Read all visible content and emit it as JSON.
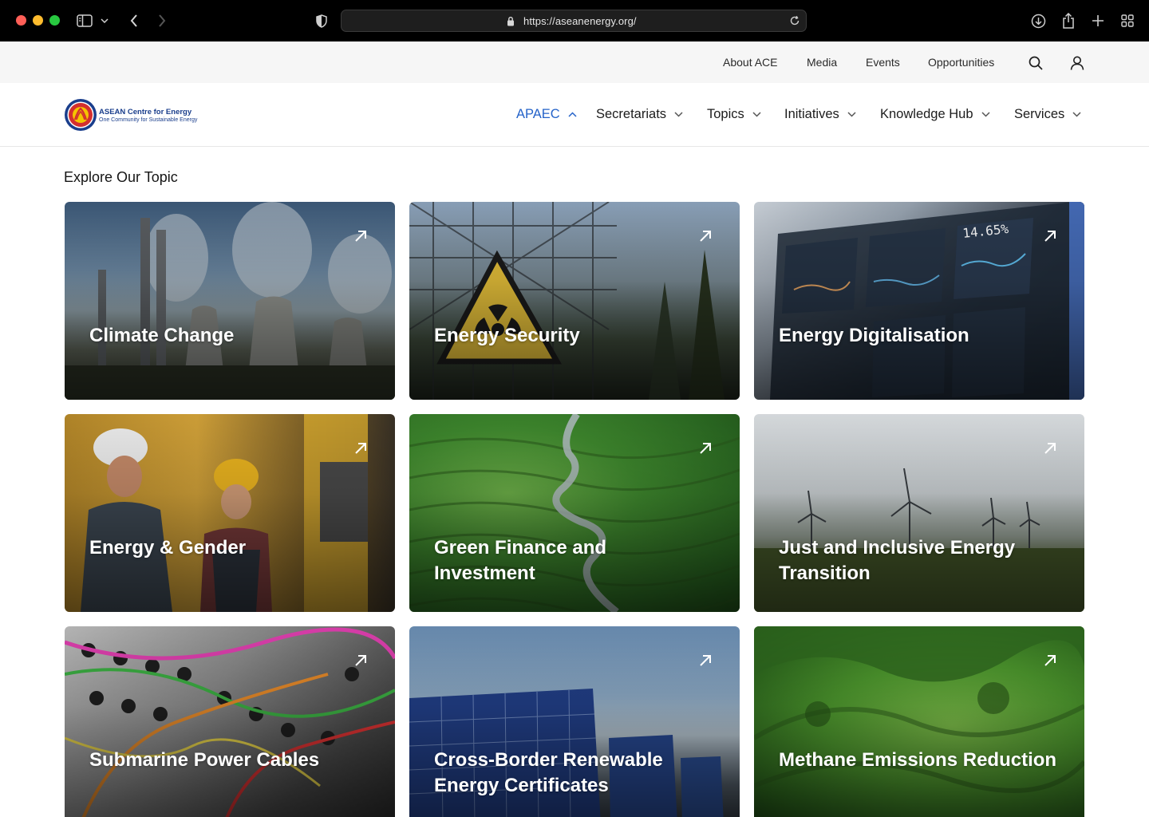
{
  "browser": {
    "url": "https://aseanenergy.org/"
  },
  "utility_nav": {
    "links": [
      "About ACE",
      "Media",
      "Events",
      "Opportunities"
    ]
  },
  "main_nav": {
    "logo_title": "ASEAN Centre for Energy",
    "logo_subtitle": "One Community for Sustainable Energy",
    "items": [
      "APAEC",
      "Secretariats",
      "Topics",
      "Initiatives",
      "Knowledge Hub",
      "Services"
    ],
    "active_index": 0,
    "accent_color": "#2563c9"
  },
  "section": {
    "title": "Explore Our Topic"
  },
  "topics": [
    {
      "label": "Climate Change"
    },
    {
      "label": "Energy Security"
    },
    {
      "label": "Energy Digitalisation"
    },
    {
      "label": "Energy & Gender"
    },
    {
      "label": "Green Finance and Investment"
    },
    {
      "label": "Just and Inclusive Energy Transition"
    },
    {
      "label": "Submarine Power Cables"
    },
    {
      "label": "Cross-Border Renewable Energy Certificates"
    },
    {
      "label": "Methane Emissions Reduction"
    }
  ]
}
